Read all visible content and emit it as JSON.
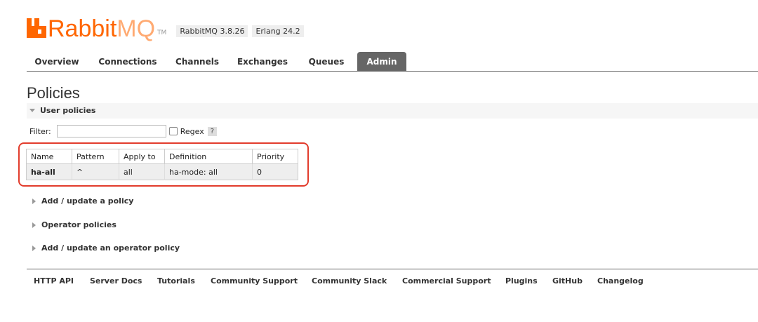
{
  "header": {
    "logo_main": "Rabbit",
    "logo_suffix": "MQ",
    "logo_tm": "TM",
    "version": "RabbitMQ 3.8.26",
    "erlang": "Erlang 24.2"
  },
  "tabs": [
    {
      "label": "Overview"
    },
    {
      "label": "Connections"
    },
    {
      "label": "Channels"
    },
    {
      "label": "Exchanges"
    },
    {
      "label": "Queues"
    },
    {
      "label": "Admin",
      "active": true
    }
  ],
  "page_title": "Policies",
  "user_policies": {
    "title": "User policies",
    "filter_label": "Filter:",
    "filter_value": "",
    "regex_label": "Regex",
    "help_label": "?",
    "columns": [
      "Name",
      "Pattern",
      "Apply to",
      "Definition",
      "Priority"
    ],
    "rows": [
      {
        "name": "ha-all",
        "pattern": "^",
        "apply_to": "all",
        "def_key": "ha-mode:",
        "def_value": "all",
        "priority": "0"
      }
    ]
  },
  "sections": [
    "Add / update a policy",
    "Operator policies",
    "Add / update an operator policy"
  ],
  "footer": [
    "HTTP API",
    "Server Docs",
    "Tutorials",
    "Community Support",
    "Community Slack",
    "Commercial Support",
    "Plugins",
    "GitHub",
    "Changelog"
  ],
  "colors": {
    "brand": "#ff6600",
    "highlight": "#e23c2c",
    "tab_active": "#666666"
  }
}
